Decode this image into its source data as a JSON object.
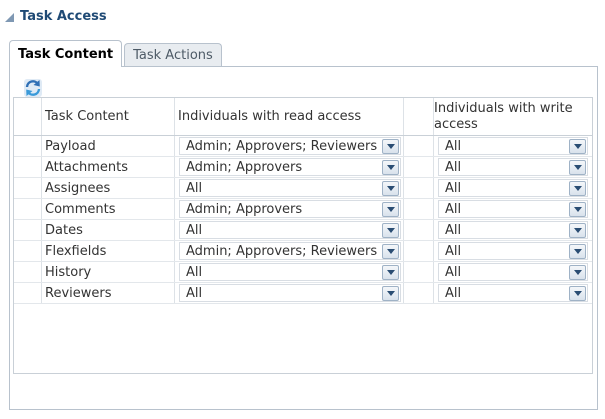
{
  "header": {
    "title": "Task Access"
  },
  "tabs": [
    {
      "label": "Task Content",
      "active": true
    },
    {
      "label": "Task Actions",
      "active": false
    }
  ],
  "toolbar": {
    "refresh_icon": "refresh-icon"
  },
  "table": {
    "columns": [
      "Task Content",
      "Individuals with read access",
      "Individuals with write access"
    ],
    "rows": [
      {
        "content": "Payload",
        "read": "Admin; Approvers; Reviewers",
        "write": "All"
      },
      {
        "content": "Attachments",
        "read": "Admin; Approvers",
        "write": "All"
      },
      {
        "content": "Assignees",
        "read": "All",
        "write": "All"
      },
      {
        "content": "Comments",
        "read": "Admin; Approvers",
        "write": "All"
      },
      {
        "content": "Dates",
        "read": "All",
        "write": "All"
      },
      {
        "content": "Flexfields",
        "read": "Admin; Approvers; Reviewers",
        "write": "All"
      },
      {
        "content": "History",
        "read": "All",
        "write": "All"
      },
      {
        "content": "Reviewers",
        "read": "All",
        "write": "All"
      }
    ]
  },
  "colors": {
    "title": "#1f4a75",
    "border": "#b8c2cd",
    "dropdown_arrow": "#2a4d73"
  }
}
